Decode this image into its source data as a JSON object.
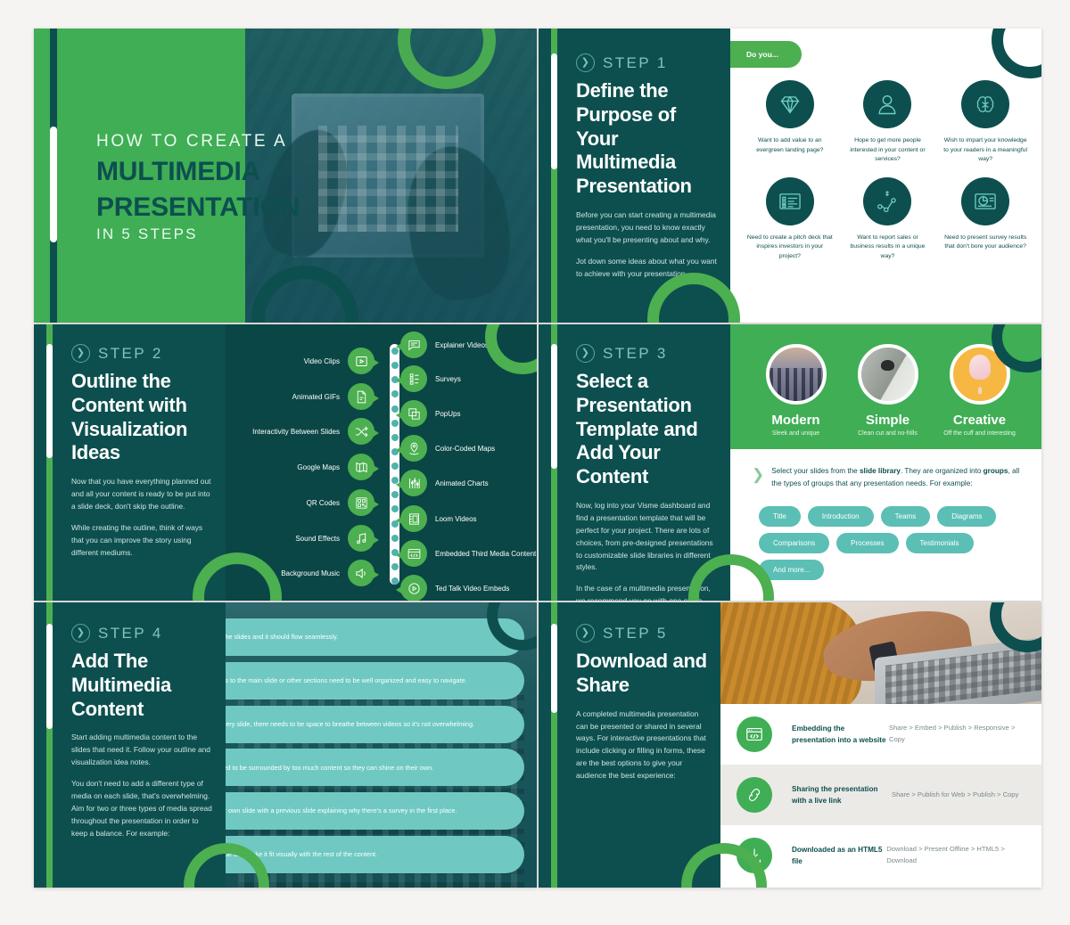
{
  "theme": {
    "green": "#3fae55",
    "bright_green": "#4caf50",
    "dark_teal": "#0d4f4f",
    "panel_teal": "#0b4646",
    "mint": "#6fc9c2",
    "pill_teal": "#5bbfb5",
    "page_bg": "#f5f4f2"
  },
  "slide1": {
    "line1": "HOW TO CREATE A",
    "line2": "MULTIMEDIA",
    "line3": "PRESENTATION",
    "line4": "IN 5 STEPS"
  },
  "slide2": {
    "step_label": "STEP 1",
    "title": "Define the Purpose of Your Multimedia Presentation",
    "body": [
      "Before you can start creating a multimedia presentation, you need to know exactly what you'll be presenting about and why.",
      "Jot down some ideas about what you want to achieve with your presentation."
    ],
    "pill": "Do you...",
    "items": [
      {
        "icon": "diamond-icon",
        "caption": "Want to add value to an evergreen landing page?"
      },
      {
        "icon": "person-icon",
        "caption": "Hope to get more people interested in your content or services?"
      },
      {
        "icon": "brain-icon",
        "caption": "Wish to impart your knowledge to your readers in a meaningful way?"
      },
      {
        "icon": "checklist-icon",
        "caption": "Need to create a pitch deck that inspires investors in your project?"
      },
      {
        "icon": "sales-graph-icon",
        "caption": "Want to report sales or business results in a unique way?"
      },
      {
        "icon": "pie-chart-icon",
        "caption": "Need to present survey results that don't bore your audience?"
      }
    ]
  },
  "slide3": {
    "step_label": "STEP 2",
    "title": "Outline the Content with Visualization Ideas",
    "body": [
      "Now that you have everything planned out and all your content is ready to be put into a slide deck, don't skip the outline.",
      "While creating the outline, think of ways that you can improve the story using different mediums."
    ],
    "left_items": [
      {
        "icon": "play-icon",
        "label": "Video Clips"
      },
      {
        "icon": "gif-icon",
        "label": "Animated GIFs"
      },
      {
        "icon": "shuffle-icon",
        "label": "Interactivity Between Slides"
      },
      {
        "icon": "map-icon",
        "label": "Google Maps"
      },
      {
        "icon": "qr-icon",
        "label": "QR Codes"
      },
      {
        "icon": "music-icon",
        "label": "Sound Effects"
      },
      {
        "icon": "speaker-icon",
        "label": "Background Music"
      }
    ],
    "right_items": [
      {
        "icon": "chat-icon",
        "label": "Explainer Videos"
      },
      {
        "icon": "survey-icon",
        "label": "Surveys"
      },
      {
        "icon": "popup-icon",
        "label": "PopUps"
      },
      {
        "icon": "pin-map-icon",
        "label": "Color-Coded Maps"
      },
      {
        "icon": "bar-chart-icon",
        "label": "Animated Charts"
      },
      {
        "icon": "film-icon",
        "label": "Loom Videos"
      },
      {
        "icon": "code-icon",
        "label": "Embedded Third Media Content"
      },
      {
        "icon": "play-circle-icon",
        "label": "Ted Talk Video Embeds"
      }
    ]
  },
  "slide4": {
    "step_label": "STEP 3",
    "title": "Select a Presentation Template and Add Your Content",
    "body": [
      "Now, log into your Visme dashboard and find a presentation template that will be perfect for your project. There are lots of choices, from pre-designed presentations to customizable slide libraries in different styles.",
      "In the case of a multimedia presentation, we recommend you go with one of the slide libraries. We have three to choose from:"
    ],
    "templates": [
      {
        "name": "Modern",
        "desc": "Sleek and unique",
        "photo": "city-skyline-photo"
      },
      {
        "name": "Simple",
        "desc": "Clean cut and no-frills",
        "photo": "desk-lamp-photo"
      },
      {
        "name": "Creative",
        "desc": "Off the cuff and interesting",
        "photo": "ice-cream-photo"
      }
    ],
    "library_text_a": "Select your slides from the ",
    "library_bold_a": "slide library",
    "library_text_b": ". They are organized into ",
    "library_bold_b": "groups",
    "library_text_c": ", all the types of groups that any presentation needs. For example:",
    "pills": [
      "Title",
      "Introduction",
      "Teams",
      "Diagrams",
      "Comparisons",
      "Processes",
      "Testimonials",
      "And more..."
    ]
  },
  "slide5": {
    "step_label": "STEP 4",
    "title": "Add The Multimedia Content",
    "body": [
      "Start adding multimedia content to the slides that need it. Follow your outline and visualization idea notes.",
      "You don't need to add a different type of media on each slide, that's overwhelming. Aim for two or three types of media spread throughout the presentation in order to keep a balance. For example:"
    ],
    "cards": [
      {
        "icon": "microphone-icon",
        "text": "A narration can cover all the slides and it should flow seamlessly."
      },
      {
        "icon": "link-graph-icon",
        "text": "Interactive slides with links to the main slide or other sections need to be well organized and easy to navigate."
      },
      {
        "icon": "video-icon",
        "text": "Videos shouldn't be on every slide, there needs to be space to breathe between videos so it's not overwhelming."
      },
      {
        "icon": "chart-icon",
        "text": "Animated charts don't need to be surrounded by too much content so they can shine on their own."
      },
      {
        "icon": "survey-check-icon",
        "text": "Surveys should have their own slide with a previous slide explaining why there's a survey in the first place."
      },
      {
        "icon": "embed-code-icon",
        "text": "Embed content on any slide and make it fit visually with the rest of the content."
      }
    ]
  },
  "slide6": {
    "step_label": "STEP 5",
    "title": "Download and Share",
    "body": [
      "A completed multimedia presentation can be presented or shared in several ways. For interactive presentations that include clicking or filling in forms, these are the best options to give your audience the best experience:"
    ],
    "hero_photo": "hands-typing-on-laptop-photo",
    "rows": [
      {
        "icon": "embed-code-icon",
        "title": "Embedding the presentation into a website",
        "path": "Share > Embed > Publish > Responsive > Copy"
      },
      {
        "icon": "link-icon",
        "title": "Sharing the presentation with a live link",
        "path": "Share > Publish for Web > Publish > Copy"
      },
      {
        "icon": "download-icon",
        "title": "Downloaded as an HTML5 file",
        "path": "Download > Present Offline > HTML5 > Download"
      }
    ]
  }
}
